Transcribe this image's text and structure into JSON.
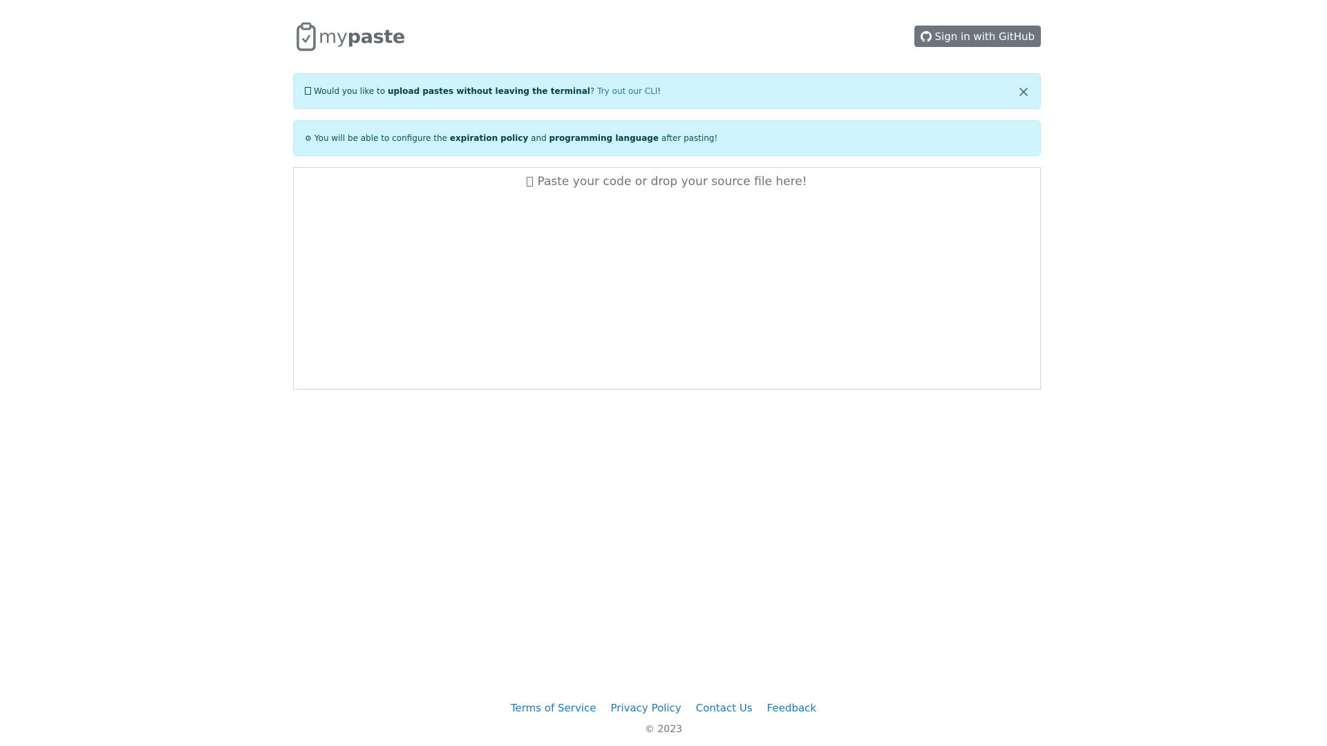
{
  "header": {
    "logo_text_light": "my",
    "logo_text_bold": "paste",
    "signin_label": "Sign in with GitHub"
  },
  "alerts": {
    "cli": {
      "prefix": "Would you like to ",
      "bold": "upload pastes without leaving the terminal",
      "middle": "? ",
      "link": "Try out our CLI",
      "suffix": "!"
    },
    "config": {
      "icon": "⚙",
      "prefix": "You will be able to configure the ",
      "bold1": "expiration policy",
      "middle": " and ",
      "bold2": "programming language",
      "suffix": " after pasting!"
    }
  },
  "editor": {
    "placeholder": "Paste your code or drop your source file here!"
  },
  "footer": {
    "links": [
      "Terms of Service",
      "Privacy Policy",
      "Contact Us",
      "Feedback"
    ],
    "copyright": "© 2023"
  },
  "colors": {
    "alert_bg": "#cff4fc",
    "alert_text": "#055160",
    "link": "#1a7bc4",
    "button_bg": "#6c757d"
  },
  "icons": {
    "logo": "clipboard-check-icon",
    "github": "github-icon",
    "close": "close-icon",
    "gear": "gear-icon"
  }
}
